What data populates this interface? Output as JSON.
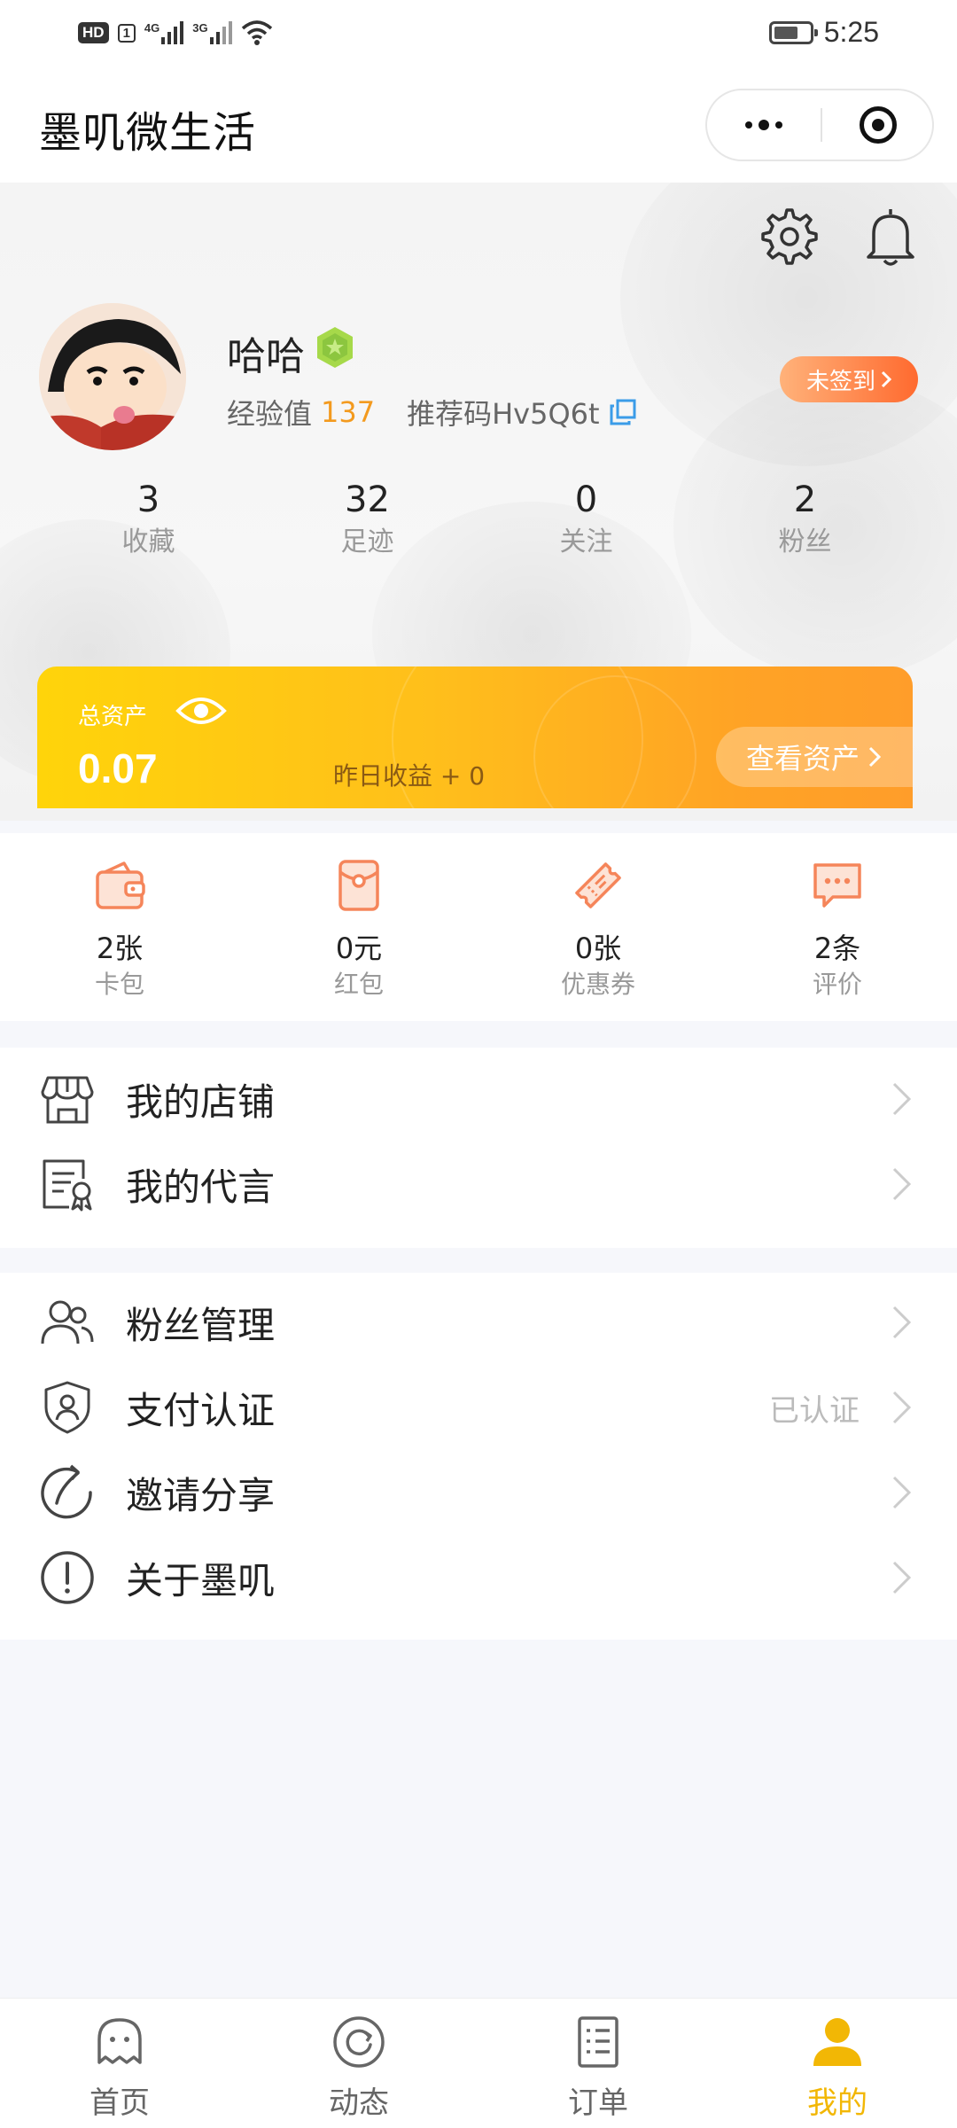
{
  "status_bar": {
    "hd": "HD",
    "sim": "1",
    "net1": "4G",
    "net2": "3G",
    "time": "5:25"
  },
  "titlebar": {
    "title": "墨叽微生活"
  },
  "profile": {
    "nickname": "哈哈",
    "exp_label": "经验值",
    "exp_value": "137",
    "referral": "推荐码Hv5Q6t",
    "signin_label": "未签到"
  },
  "stats": [
    {
      "value": "3",
      "label": "收藏"
    },
    {
      "value": "32",
      "label": "足迹"
    },
    {
      "value": "0",
      "label": "关注"
    },
    {
      "value": "2",
      "label": "粉丝"
    }
  ],
  "assets": {
    "label": "总资产",
    "value": "0.07",
    "yesterday": "昨日收益 + 0",
    "view_button": "查看资产"
  },
  "wallet": [
    {
      "icon": "wallet-icon",
      "value": "2张",
      "label": "卡包"
    },
    {
      "icon": "red-packet-icon",
      "value": "0元",
      "label": "红包"
    },
    {
      "icon": "coupon-icon",
      "value": "0张",
      "label": "优惠券"
    },
    {
      "icon": "comment-icon",
      "value": "2条",
      "label": "评价"
    }
  ],
  "menu_group_1": [
    {
      "icon": "shop-icon",
      "label": "我的店铺",
      "value": ""
    },
    {
      "icon": "certificate-icon",
      "label": "我的代言",
      "value": ""
    }
  ],
  "menu_group_2": [
    {
      "icon": "users-icon",
      "label": "粉丝管理",
      "value": ""
    },
    {
      "icon": "shield-user-icon",
      "label": "支付认证",
      "value": "已认证"
    },
    {
      "icon": "share-icon",
      "label": "邀请分享",
      "value": ""
    },
    {
      "icon": "info-icon",
      "label": "关于墨叽",
      "value": ""
    }
  ],
  "tabs": [
    {
      "icon": "ghost-home-icon",
      "label": "首页",
      "active": false
    },
    {
      "icon": "refresh-circle-icon",
      "label": "动态",
      "active": false
    },
    {
      "icon": "order-list-icon",
      "label": "订单",
      "active": false
    },
    {
      "icon": "user-icon",
      "label": "我的",
      "active": true
    }
  ],
  "colors": {
    "accent": "#f2b705",
    "orange": "#f39a1e",
    "icon_orange": "#f5855a",
    "signin_gradient_end": "#ff6a2f"
  }
}
